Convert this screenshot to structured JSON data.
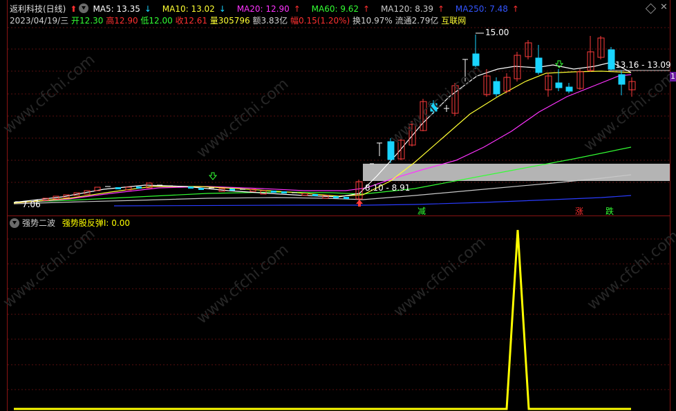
{
  "header": {
    "title": "返利科技(日线)",
    "ma_items": [
      {
        "label": "MA5: 13.35",
        "arrow": "↓",
        "color": "#ffffff",
        "arrow_color": "#19d4ff"
      },
      {
        "label": "MA10: 13.02",
        "arrow": "↓",
        "color": "#ffff33",
        "arrow_color": "#19d4ff"
      },
      {
        "label": "MA20: 12.90",
        "arrow": "↑",
        "color": "#ff33ff",
        "arrow_color": "#ff3030"
      },
      {
        "label": "MA60: 9.62",
        "arrow": "↑",
        "color": "#33ff33",
        "arrow_color": "#ff3030"
      },
      {
        "label": "MA120: 8.39",
        "arrow": "↑",
        "color": "#c8c8c8",
        "arrow_color": "#ff3030"
      },
      {
        "label": "MA250: 7.48",
        "arrow": "↑",
        "color": "#3355ff",
        "arrow_color": "#ff3030"
      }
    ]
  },
  "info": {
    "date": "2023/04/19/三",
    "open": "开12.30",
    "high": "高12.90",
    "low": "低12.00",
    "close": "收12.61",
    "volume": "量305796",
    "amount": "额3.83亿",
    "change": "幅0.15(1.20%)",
    "turnover": "换10.97%",
    "float": "流通2.79亿",
    "sector": "互联网"
  },
  "annotations": {
    "high_price": "15.00",
    "low_price": "7.06",
    "range_right": "13.16 - 13.09",
    "zone_label": "8.10 - 8.91",
    "side_tab": "1",
    "tag_reduce": "减",
    "tag_up": "涨",
    "tag_down": "跌"
  },
  "indicator": {
    "name": "强势二波",
    "label": "强势股反弹I: 0.00",
    "signal_value": 1,
    "color": "#ffff00"
  },
  "watermark": "www.cfchi.com",
  "colors": {
    "up": "#ff3b3b",
    "down": "#19d4ff",
    "bg": "#000000",
    "border": "#8a1414"
  }
}
